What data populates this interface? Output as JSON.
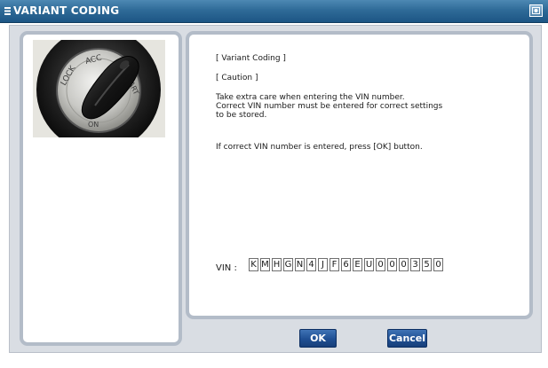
{
  "window": {
    "title": "VARIANT CODING"
  },
  "photo": {
    "icon": "ignition-key-switch-photo",
    "labels": [
      "LOCK",
      "ACC",
      "START",
      "ON"
    ]
  },
  "message": {
    "heading": "[ Variant Coding ]",
    "caution": "[ Caution ]",
    "body_line1": "Take extra care when entering the VIN number.",
    "body_line2": "Correct VIN number must be entered for correct settings",
    "body_line3": "to be stored.",
    "instruction": "If correct VIN number is entered, press [OK] button."
  },
  "vin": {
    "label": "VIN :",
    "chars": [
      "K",
      "M",
      "H",
      "G",
      "N",
      "4",
      "J",
      "F",
      "6",
      "E",
      "U",
      "0",
      "0",
      "0",
      "3",
      "5",
      "0"
    ]
  },
  "buttons": {
    "ok": "OK",
    "cancel": "Cancel"
  },
  "colors": {
    "title_bar": "#2f6b98",
    "button": "#1f4f93",
    "panel_border": "#b3bcc8"
  }
}
